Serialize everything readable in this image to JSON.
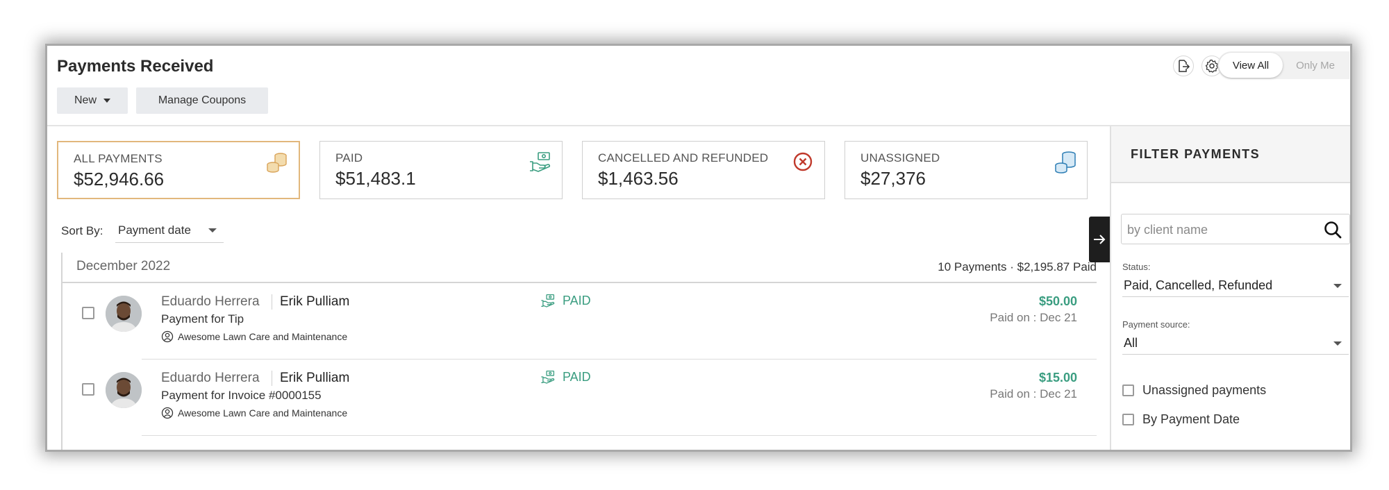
{
  "header": {
    "title": "Payments Received",
    "new_label": "New",
    "manage_coupons_label": "Manage Coupons",
    "view_all_label": "View All",
    "only_me_label": "Only Me",
    "icons": [
      "export-icon",
      "gear-icon"
    ]
  },
  "cards": [
    {
      "label": "ALL PAYMENTS",
      "value": "$52,946.66",
      "icon": "coins-icon",
      "active": true
    },
    {
      "label": "PAID",
      "value": "$51,483.1",
      "icon": "hand-money-icon"
    },
    {
      "label": "CANCELLED AND REFUNDED",
      "value": "$1,463.56",
      "icon": "cancel-circle-icon"
    },
    {
      "label": "UNASSIGNED",
      "value": "$27,376",
      "icon": "coin-stack-icon"
    }
  ],
  "sort": {
    "label": "Sort By:",
    "value": "Payment date"
  },
  "list": {
    "month": "December 2022",
    "summary": "10 Payments  ·  $2,195.87 Paid",
    "rows": [
      {
        "client": "Eduardo Herrera",
        "staff": "Erik Pulliam",
        "description": "Payment for Tip",
        "company": "Awesome Lawn Care and Maintenance",
        "status": "PAID",
        "amount": "$50.00",
        "paid_on": "Paid on : Dec 21"
      },
      {
        "client": "Eduardo Herrera",
        "staff": "Erik Pulliam",
        "description": "Payment for Invoice #0000155",
        "company": "Awesome Lawn Care and Maintenance",
        "status": "PAID",
        "amount": "$15.00",
        "paid_on": "Paid on : Dec 21"
      }
    ]
  },
  "filter": {
    "title": "FILTER PAYMENTS",
    "search_placeholder": "by client name",
    "status_label": "Status:",
    "status_value": "Paid, Cancelled, Refunded",
    "source_label": "Payment source:",
    "source_value": "All",
    "checkboxes": [
      "Unassigned payments",
      "By Payment Date"
    ]
  },
  "colors": {
    "accent_gold": "#e2b77c",
    "paid_green": "#3a9d80",
    "cancel_red": "#c0392b",
    "unassigned_blue": "#2f7fb5"
  }
}
